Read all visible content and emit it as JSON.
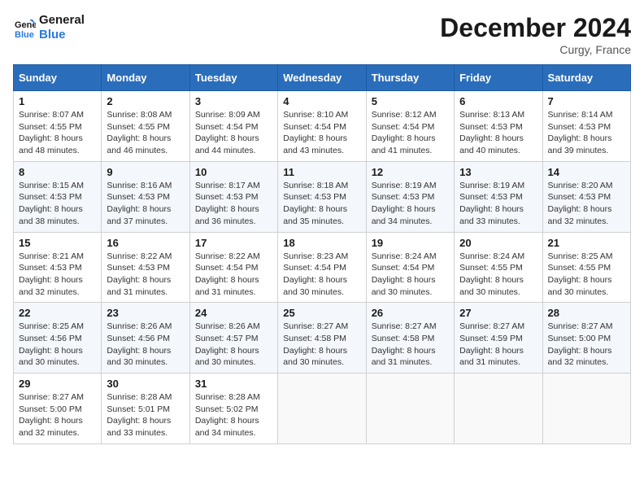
{
  "header": {
    "logo_line1": "General",
    "logo_line2": "Blue",
    "month": "December 2024",
    "location": "Curgy, France"
  },
  "days_of_week": [
    "Sunday",
    "Monday",
    "Tuesday",
    "Wednesday",
    "Thursday",
    "Friday",
    "Saturday"
  ],
  "weeks": [
    [
      {
        "day": "1",
        "sunrise": "8:07 AM",
        "sunset": "4:55 PM",
        "daylight": "8 hours and 48 minutes."
      },
      {
        "day": "2",
        "sunrise": "8:08 AM",
        "sunset": "4:55 PM",
        "daylight": "8 hours and 46 minutes."
      },
      {
        "day": "3",
        "sunrise": "8:09 AM",
        "sunset": "4:54 PM",
        "daylight": "8 hours and 44 minutes."
      },
      {
        "day": "4",
        "sunrise": "8:10 AM",
        "sunset": "4:54 PM",
        "daylight": "8 hours and 43 minutes."
      },
      {
        "day": "5",
        "sunrise": "8:12 AM",
        "sunset": "4:54 PM",
        "daylight": "8 hours and 41 minutes."
      },
      {
        "day": "6",
        "sunrise": "8:13 AM",
        "sunset": "4:53 PM",
        "daylight": "8 hours and 40 minutes."
      },
      {
        "day": "7",
        "sunrise": "8:14 AM",
        "sunset": "4:53 PM",
        "daylight": "8 hours and 39 minutes."
      }
    ],
    [
      {
        "day": "8",
        "sunrise": "8:15 AM",
        "sunset": "4:53 PM",
        "daylight": "8 hours and 38 minutes."
      },
      {
        "day": "9",
        "sunrise": "8:16 AM",
        "sunset": "4:53 PM",
        "daylight": "8 hours and 37 minutes."
      },
      {
        "day": "10",
        "sunrise": "8:17 AM",
        "sunset": "4:53 PM",
        "daylight": "8 hours and 36 minutes."
      },
      {
        "day": "11",
        "sunrise": "8:18 AM",
        "sunset": "4:53 PM",
        "daylight": "8 hours and 35 minutes."
      },
      {
        "day": "12",
        "sunrise": "8:19 AM",
        "sunset": "4:53 PM",
        "daylight": "8 hours and 34 minutes."
      },
      {
        "day": "13",
        "sunrise": "8:19 AM",
        "sunset": "4:53 PM",
        "daylight": "8 hours and 33 minutes."
      },
      {
        "day": "14",
        "sunrise": "8:20 AM",
        "sunset": "4:53 PM",
        "daylight": "8 hours and 32 minutes."
      }
    ],
    [
      {
        "day": "15",
        "sunrise": "8:21 AM",
        "sunset": "4:53 PM",
        "daylight": "8 hours and 32 minutes."
      },
      {
        "day": "16",
        "sunrise": "8:22 AM",
        "sunset": "4:53 PM",
        "daylight": "8 hours and 31 minutes."
      },
      {
        "day": "17",
        "sunrise": "8:22 AM",
        "sunset": "4:54 PM",
        "daylight": "8 hours and 31 minutes."
      },
      {
        "day": "18",
        "sunrise": "8:23 AM",
        "sunset": "4:54 PM",
        "daylight": "8 hours and 30 minutes."
      },
      {
        "day": "19",
        "sunrise": "8:24 AM",
        "sunset": "4:54 PM",
        "daylight": "8 hours and 30 minutes."
      },
      {
        "day": "20",
        "sunrise": "8:24 AM",
        "sunset": "4:55 PM",
        "daylight": "8 hours and 30 minutes."
      },
      {
        "day": "21",
        "sunrise": "8:25 AM",
        "sunset": "4:55 PM",
        "daylight": "8 hours and 30 minutes."
      }
    ],
    [
      {
        "day": "22",
        "sunrise": "8:25 AM",
        "sunset": "4:56 PM",
        "daylight": "8 hours and 30 minutes."
      },
      {
        "day": "23",
        "sunrise": "8:26 AM",
        "sunset": "4:56 PM",
        "daylight": "8 hours and 30 minutes."
      },
      {
        "day": "24",
        "sunrise": "8:26 AM",
        "sunset": "4:57 PM",
        "daylight": "8 hours and 30 minutes."
      },
      {
        "day": "25",
        "sunrise": "8:27 AM",
        "sunset": "4:58 PM",
        "daylight": "8 hours and 30 minutes."
      },
      {
        "day": "26",
        "sunrise": "8:27 AM",
        "sunset": "4:58 PM",
        "daylight": "8 hours and 31 minutes."
      },
      {
        "day": "27",
        "sunrise": "8:27 AM",
        "sunset": "4:59 PM",
        "daylight": "8 hours and 31 minutes."
      },
      {
        "day": "28",
        "sunrise": "8:27 AM",
        "sunset": "5:00 PM",
        "daylight": "8 hours and 32 minutes."
      }
    ],
    [
      {
        "day": "29",
        "sunrise": "8:27 AM",
        "sunset": "5:00 PM",
        "daylight": "8 hours and 32 minutes."
      },
      {
        "day": "30",
        "sunrise": "8:28 AM",
        "sunset": "5:01 PM",
        "daylight": "8 hours and 33 minutes."
      },
      {
        "day": "31",
        "sunrise": "8:28 AM",
        "sunset": "5:02 PM",
        "daylight": "8 hours and 34 minutes."
      },
      null,
      null,
      null,
      null
    ]
  ]
}
